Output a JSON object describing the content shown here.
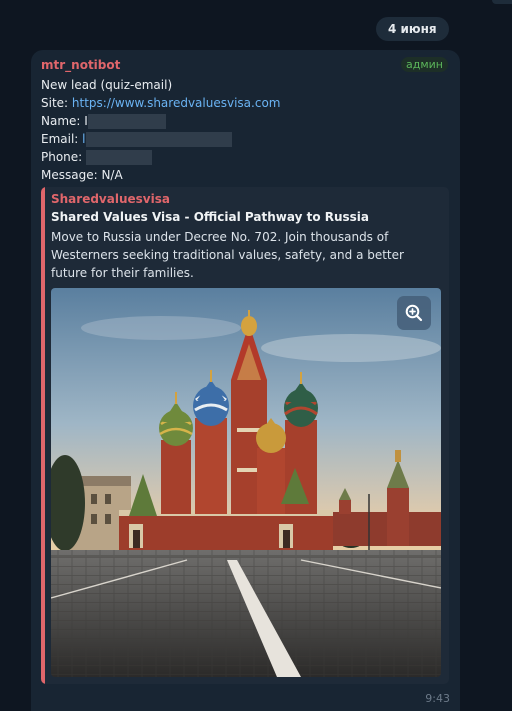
{
  "date_label": "4 июня",
  "message": {
    "sender": "mtr_notibot",
    "role_badge": "админ",
    "line1": "New lead (quiz-email)",
    "site_label": "Site: ",
    "site_url": "https://www.sharedvaluesvisa.com",
    "name_label": "Name: ",
    "name_value": "I",
    "email_label": "Email: ",
    "email_value": "l",
    "phone_label": "Phone: ",
    "message_label": "Message: ",
    "message_value": "N/A",
    "time": "9:43"
  },
  "preview": {
    "site_name": "Sharedvaluesvisa",
    "title": "Shared Values Visa - Official Pathway to Russia",
    "description": "Move to Russia under Decree No. 702. Join thousands of Westerners seeking traditional values, safety, and a better future for their families."
  },
  "colors": {
    "background": "#0e1621",
    "bubble": "#182533",
    "accent_red": "#e0666b",
    "link": "#6ab3f3",
    "admin_green": "#5bb55a"
  }
}
